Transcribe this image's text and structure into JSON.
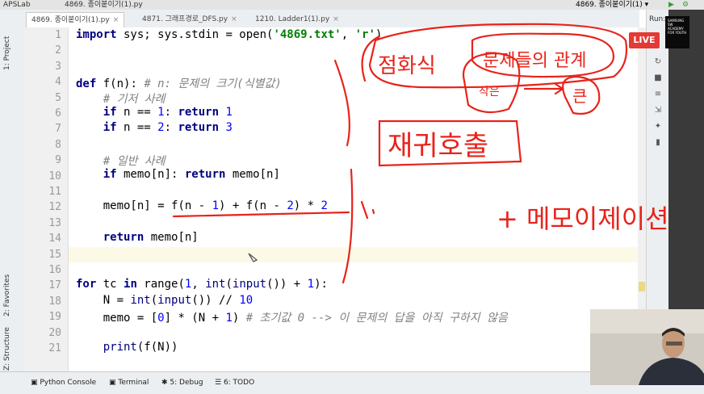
{
  "titlebar": {
    "project": "APSLab",
    "path": "4869. 종이붙이기(1).py",
    "run_config": "4869. 종이붙이기(1) ▾",
    "run_label": "Run:"
  },
  "tabs": [
    {
      "label": "4869. 종이붙이기(1).py"
    },
    {
      "label": "4871. 그래프경로_DFS.py"
    },
    {
      "label": "1210. Ladder1(1).py"
    }
  ],
  "left_panel": {
    "project": "1: Project",
    "favorites": "2: Favorites",
    "structure": "Z: Structure"
  },
  "line_numbers": [
    "1",
    "2",
    "3",
    "4",
    "5",
    "6",
    "7",
    "8",
    "9",
    "10",
    "11",
    "12",
    "13",
    "14",
    "15",
    "16",
    "17",
    "18",
    "19",
    "20",
    "21"
  ],
  "code": {
    "l1": {
      "kw": "import",
      "rest": " sys; sys.stdin = open(",
      "s1": "'4869.txt'",
      "sep": ", ",
      "s2": "'r'",
      "end": ")"
    },
    "l4": {
      "kw": "def",
      "rest": " f(n): ",
      "cmt": "# n: 문제의 크기(식별값)"
    },
    "l5": {
      "cmt": "# 기저 사례"
    },
    "l6": {
      "kw": "if",
      "mid": " n == ",
      "num": "1",
      "sep": ": ",
      "kw2": "return",
      "num2": " 1"
    },
    "l7": {
      "kw": "if",
      "mid": " n == ",
      "num": "2",
      "sep": ": ",
      "kw2": "return",
      "num2": " 3"
    },
    "l9": {
      "cmt": "# 일반 사례"
    },
    "l10": {
      "kw": "if",
      "mid": " memo[n]: ",
      "kw2": "return",
      "rest": " memo[n]"
    },
    "l12": {
      "a": "memo[n] = f(n - ",
      "n1": "1",
      "b": ") + f(n - ",
      "n2": "2",
      "c": ") * ",
      "n3": "2"
    },
    "l14": {
      "kw": "return",
      "rest": " memo[n]"
    },
    "l17": {
      "kw": "for",
      "a": " tc ",
      "kw2": "in",
      "b": " range(",
      "n1": "1",
      "c": ", ",
      "bi": "int",
      "d": "(",
      "bi2": "input",
      "e": "()) + ",
      "n2": "1",
      "f": "):"
    },
    "l18": {
      "a": "N = ",
      "bi": "int",
      "b": "(",
      "bi2": "input",
      "c": "()) // ",
      "n": "10"
    },
    "l19": {
      "a": "memo = [",
      "n1": "0",
      "b": "] * (N + ",
      "n2": "1",
      "c": ") ",
      "cmt": "# 초기값 0 --> 이 문제의 답을 아직 구하지 않음"
    },
    "l21": {
      "bi": "print",
      "rest": "(f(N))"
    }
  },
  "live_badge": "LIVE",
  "samsung_badge": "SAMSUNG SW ACADEMY FOR YOUTH",
  "bottom_tabs": [
    "Python Console",
    "Terminal",
    "5: Debug",
    "6: TODO"
  ],
  "handwriting": {
    "h1": "점화식",
    "h2": "문제들의 관계",
    "h3": "작은",
    "h4": "큰",
    "h5": "재귀호출",
    "h6": "+ 메모이제이션"
  },
  "colors": {
    "ink": "#e8231a",
    "live": "#e53935",
    "keyword": "#000080",
    "string": "#008000",
    "number": "#0000ff",
    "comment": "#808080"
  }
}
